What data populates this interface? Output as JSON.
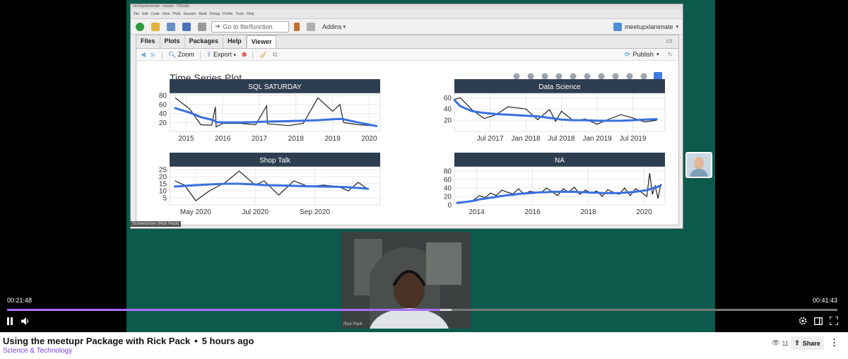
{
  "rstudio": {
    "window_title": "meetupxlanimate - master - RStudio",
    "menu": [
      "File",
      "Edit",
      "Code",
      "View",
      "Plots",
      "Session",
      "Build",
      "Debug",
      "Profile",
      "Tools",
      "Help"
    ],
    "goto_placeholder": "Go to file/function",
    "addins_label": "Addins",
    "project_label": "meetupxlanimate",
    "tabs": [
      "Files",
      "Plots",
      "Packages",
      "Help",
      "Viewer"
    ],
    "active_tab": "Viewer",
    "zoom_label": "Zoom",
    "export_label": "Export",
    "publish_label": "Publish"
  },
  "plot": {
    "main_title": "Time Series Plot",
    "modebar_icons": [
      "camera-icon",
      "zoom-icon",
      "pan-icon",
      "zoom-in-icon",
      "zoom-out-icon",
      "autoscale-icon",
      "home-icon",
      "spike-lines-icon",
      "hover-closest-icon",
      "hover-compare-icon",
      "plotly-logo-icon"
    ]
  },
  "chart_data": [
    {
      "type": "line",
      "title": "SQL SATURDAY",
      "x_ticks": [
        "2015",
        "2016",
        "2017",
        "2018",
        "2019",
        "2020"
      ],
      "y_ticks": [
        "80",
        "60",
        "40",
        "20"
      ],
      "ylim": [
        0,
        85
      ],
      "x": [
        2014.7,
        2015.1,
        2015.4,
        2015.7,
        2015.8,
        2015.82,
        2016.0,
        2016.5,
        2016.9,
        2017.2,
        2017.22,
        2017.8,
        2018.2,
        2018.6,
        2019.0,
        2019.2,
        2019.3,
        2019.7,
        2020.2
      ],
      "values": [
        75,
        50,
        15,
        14,
        55,
        10,
        18,
        18,
        15,
        57,
        17,
        13,
        18,
        75,
        45,
        60,
        20,
        15,
        12
      ],
      "trend_values": [
        52,
        42,
        32,
        26,
        23,
        21,
        20,
        20,
        21,
        22,
        22,
        23,
        24,
        25,
        27,
        28,
        27,
        20,
        12
      ],
      "grid": true
    },
    {
      "type": "line",
      "title": "Data Science",
      "x_ticks": [
        "Jul 2017",
        "Jan 2018",
        "Jul 2018",
        "Jan 2019",
        "Jul 2019"
      ],
      "y_ticks": [
        "60",
        "40",
        "20"
      ],
      "ylim": [
        0,
        68
      ],
      "x": [
        "2017-01",
        "2017-02",
        "2017-04",
        "2017-06",
        "2017-08",
        "2017-10",
        "2018-01",
        "2018-03",
        "2018-05",
        "2018-06",
        "2018-07",
        "2018-09",
        "2018-11",
        "2019-01",
        "2019-03",
        "2019-05",
        "2019-07",
        "2019-09",
        "2019-11"
      ],
      "values": [
        57,
        60,
        38,
        23,
        30,
        44,
        40,
        21,
        39,
        18,
        36,
        19,
        22,
        13,
        22,
        30,
        24,
        17,
        20
      ],
      "trend_values": [
        56,
        45,
        36,
        33,
        31,
        30,
        28,
        27,
        24,
        23,
        21,
        20,
        20,
        19,
        19,
        19,
        20,
        21,
        22
      ],
      "grid": true
    },
    {
      "type": "line",
      "title": "Shop Talk",
      "x_ticks": [
        "May 2020",
        "Jul 2020",
        "Sep 2020"
      ],
      "y_ticks": [
        "25",
        "20",
        "15",
        "10",
        "5"
      ],
      "ylim": [
        0,
        27
      ],
      "x": [
        "2020-04-10",
        "2020-04-20",
        "2020-05-01",
        "2020-05-15",
        "2020-06-01",
        "2020-06-15",
        "2020-07-01",
        "2020-07-10",
        "2020-07-25",
        "2020-08-10",
        "2020-08-25",
        "2020-09-10",
        "2020-09-25",
        "2020-10-05",
        "2020-10-15",
        "2020-10-25"
      ],
      "values": [
        17,
        14,
        3,
        10,
        16,
        24,
        14,
        17,
        7,
        17,
        13,
        14,
        13,
        10,
        16,
        11
      ],
      "trend_values": [
        13,
        13.5,
        14,
        14.5,
        15,
        15,
        14.5,
        14,
        13.8,
        13.5,
        13.2,
        13,
        12.8,
        12.5,
        12,
        11.5
      ],
      "grid": true
    },
    {
      "type": "line",
      "title": "NA",
      "x_ticks": [
        "2014",
        "2016",
        "2018",
        "2020"
      ],
      "y_ticks": [
        "80",
        "60",
        "40",
        "20",
        "0"
      ],
      "ylim": [
        0,
        90
      ],
      "x": [
        2013.3,
        2013.6,
        2013.9,
        2014.1,
        2014.3,
        2014.5,
        2014.7,
        2014.9,
        2015.1,
        2015.3,
        2015.5,
        2015.7,
        2015.9,
        2016.1,
        2016.3,
        2016.5,
        2016.7,
        2016.9,
        2017.1,
        2017.3,
        2017.5,
        2017.7,
        2017.9,
        2018.1,
        2018.3,
        2018.5,
        2018.7,
        2018.9,
        2019.1,
        2019.3,
        2019.5,
        2019.7,
        2019.9,
        2020.1,
        2020.2,
        2020.3,
        2020.4,
        2020.5,
        2020.6
      ],
      "values": [
        3,
        6,
        12,
        22,
        17,
        28,
        22,
        35,
        30,
        26,
        38,
        25,
        32,
        30,
        28,
        40,
        31,
        22,
        38,
        30,
        42,
        25,
        35,
        28,
        33,
        20,
        36,
        30,
        25,
        40,
        22,
        38,
        30,
        20,
        75,
        25,
        45,
        15,
        50
      ],
      "trend_values": [
        5,
        7,
        10,
        13,
        15,
        17,
        19,
        21,
        23,
        24,
        26,
        27,
        28,
        29,
        30,
        30,
        31,
        31,
        31,
        31,
        31,
        30,
        30,
        29,
        29,
        28,
        28,
        28,
        28,
        29,
        30,
        31,
        33,
        35,
        37,
        39,
        41,
        43,
        46
      ],
      "grid": true
    }
  ],
  "screenshare_label": "Screenshare (Rick Pack)",
  "webcam_label": "Rick Pack",
  "player": {
    "time_elapsed": "00:21:48",
    "time_total": "00:41:43",
    "progress_played": 0.522,
    "progress_buffered": 0.535
  },
  "video": {
    "title": "Using the meetupr Package with Rick Pack",
    "separator": "•",
    "age": "5 hours ago",
    "category": "Science & Technology",
    "viewers": "11",
    "share_label": "Share"
  },
  "colors": {
    "stage_bg": "#0b5a4c",
    "accent": "#a970ff",
    "facet_header": "#2d3e50",
    "trend": "#3a6fe0",
    "series": "#222222"
  }
}
